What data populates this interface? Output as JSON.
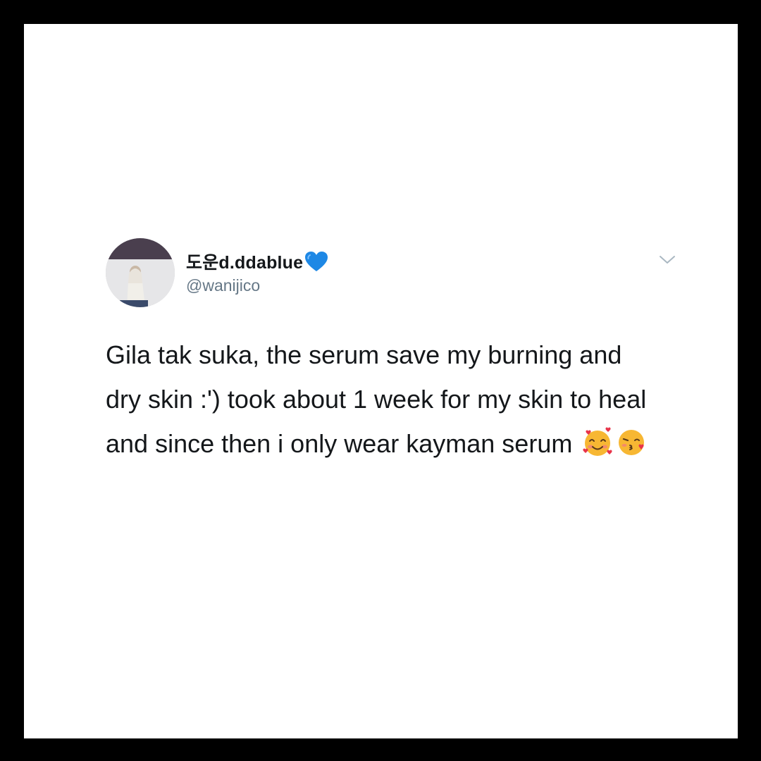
{
  "tweet": {
    "display_name": "도운d.ddablue",
    "handle": "@wanijico",
    "verified_icon": "blue-heart-icon",
    "menu_icon": "chevron-down-icon",
    "text": "Gila tak suka, the serum save my burning and dry skin :') took about 1 week for my skin to heal and since then i only wear kayman serum",
    "emojis": [
      "smiling-face-with-hearts-icon",
      "face-blowing-kiss-icon"
    ]
  },
  "colors": {
    "background": "#000000",
    "card": "#ffffff",
    "text": "#14171a",
    "muted": "#657786",
    "heart": "#1e88e5"
  }
}
